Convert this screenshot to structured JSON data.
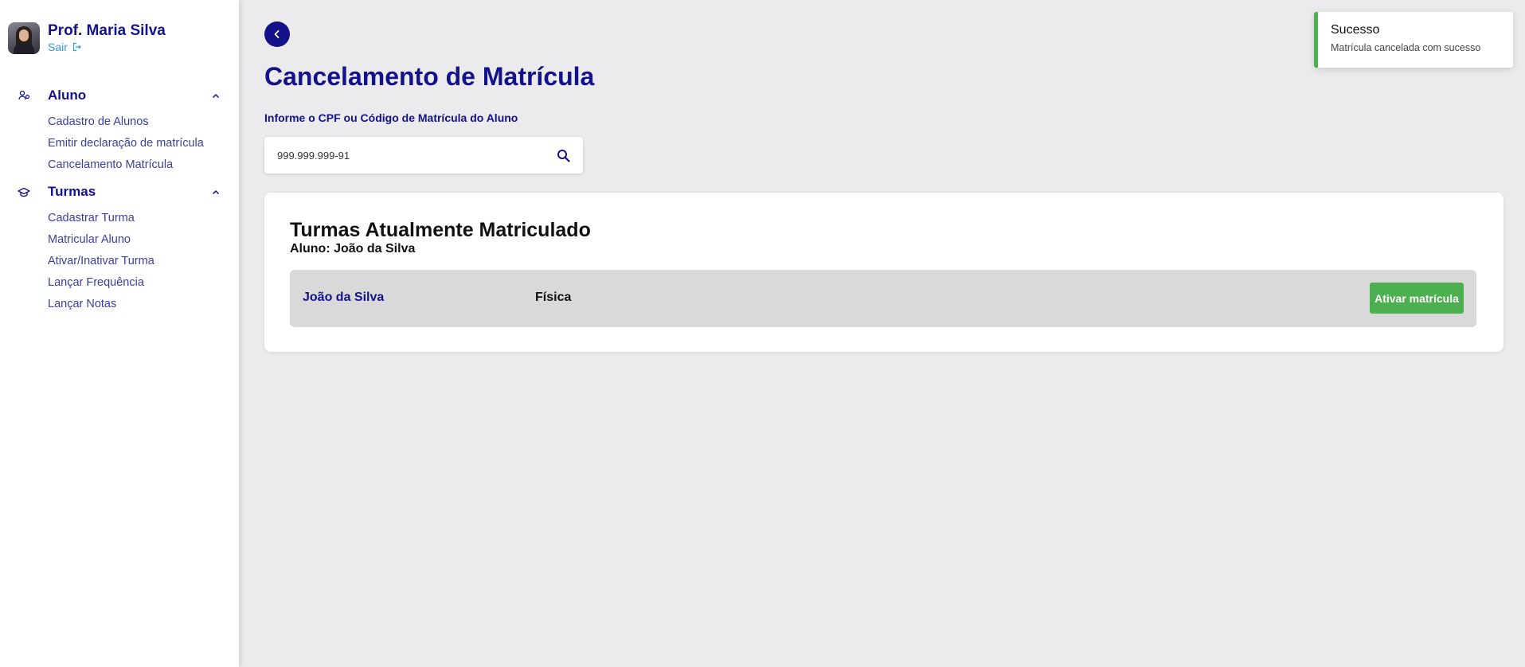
{
  "user": {
    "name": "Prof. Maria Silva",
    "logout_label": "Sair"
  },
  "sidebar": {
    "sections": [
      {
        "label": "Aluno",
        "icon": "users-icon",
        "items": [
          {
            "label": "Cadastro de Alunos"
          },
          {
            "label": "Emitir declaração de matrícula"
          },
          {
            "label": "Cancelamento Matrícula"
          }
        ]
      },
      {
        "label": "Turmas",
        "icon": "graduation-cap-icon",
        "items": [
          {
            "label": "Cadastrar Turma"
          },
          {
            "label": "Matricular Aluno"
          },
          {
            "label": "Ativar/Inativar Turma"
          },
          {
            "label": "Lançar Frequência"
          },
          {
            "label": "Lançar Notas"
          }
        ]
      }
    ]
  },
  "main": {
    "title": "Cancelamento de Matrícula",
    "search": {
      "label": "Informe o CPF ou Código de Matrícula do Aluno",
      "value": "999.999.999-91"
    },
    "card": {
      "title": "Turmas Atualmente Matriculado",
      "subtitle": "Aluno: João da Silva",
      "rows": [
        {
          "student": "João da Silva",
          "class": "Física",
          "action_label": "Ativar matrícula"
        }
      ]
    }
  },
  "toast": {
    "title": "Sucesso",
    "message": "Matrícula cancelada com sucesso"
  },
  "colors": {
    "primary": "#13128b",
    "success": "#4caf50",
    "link": "#2b9be6",
    "background": "#ebebed"
  }
}
